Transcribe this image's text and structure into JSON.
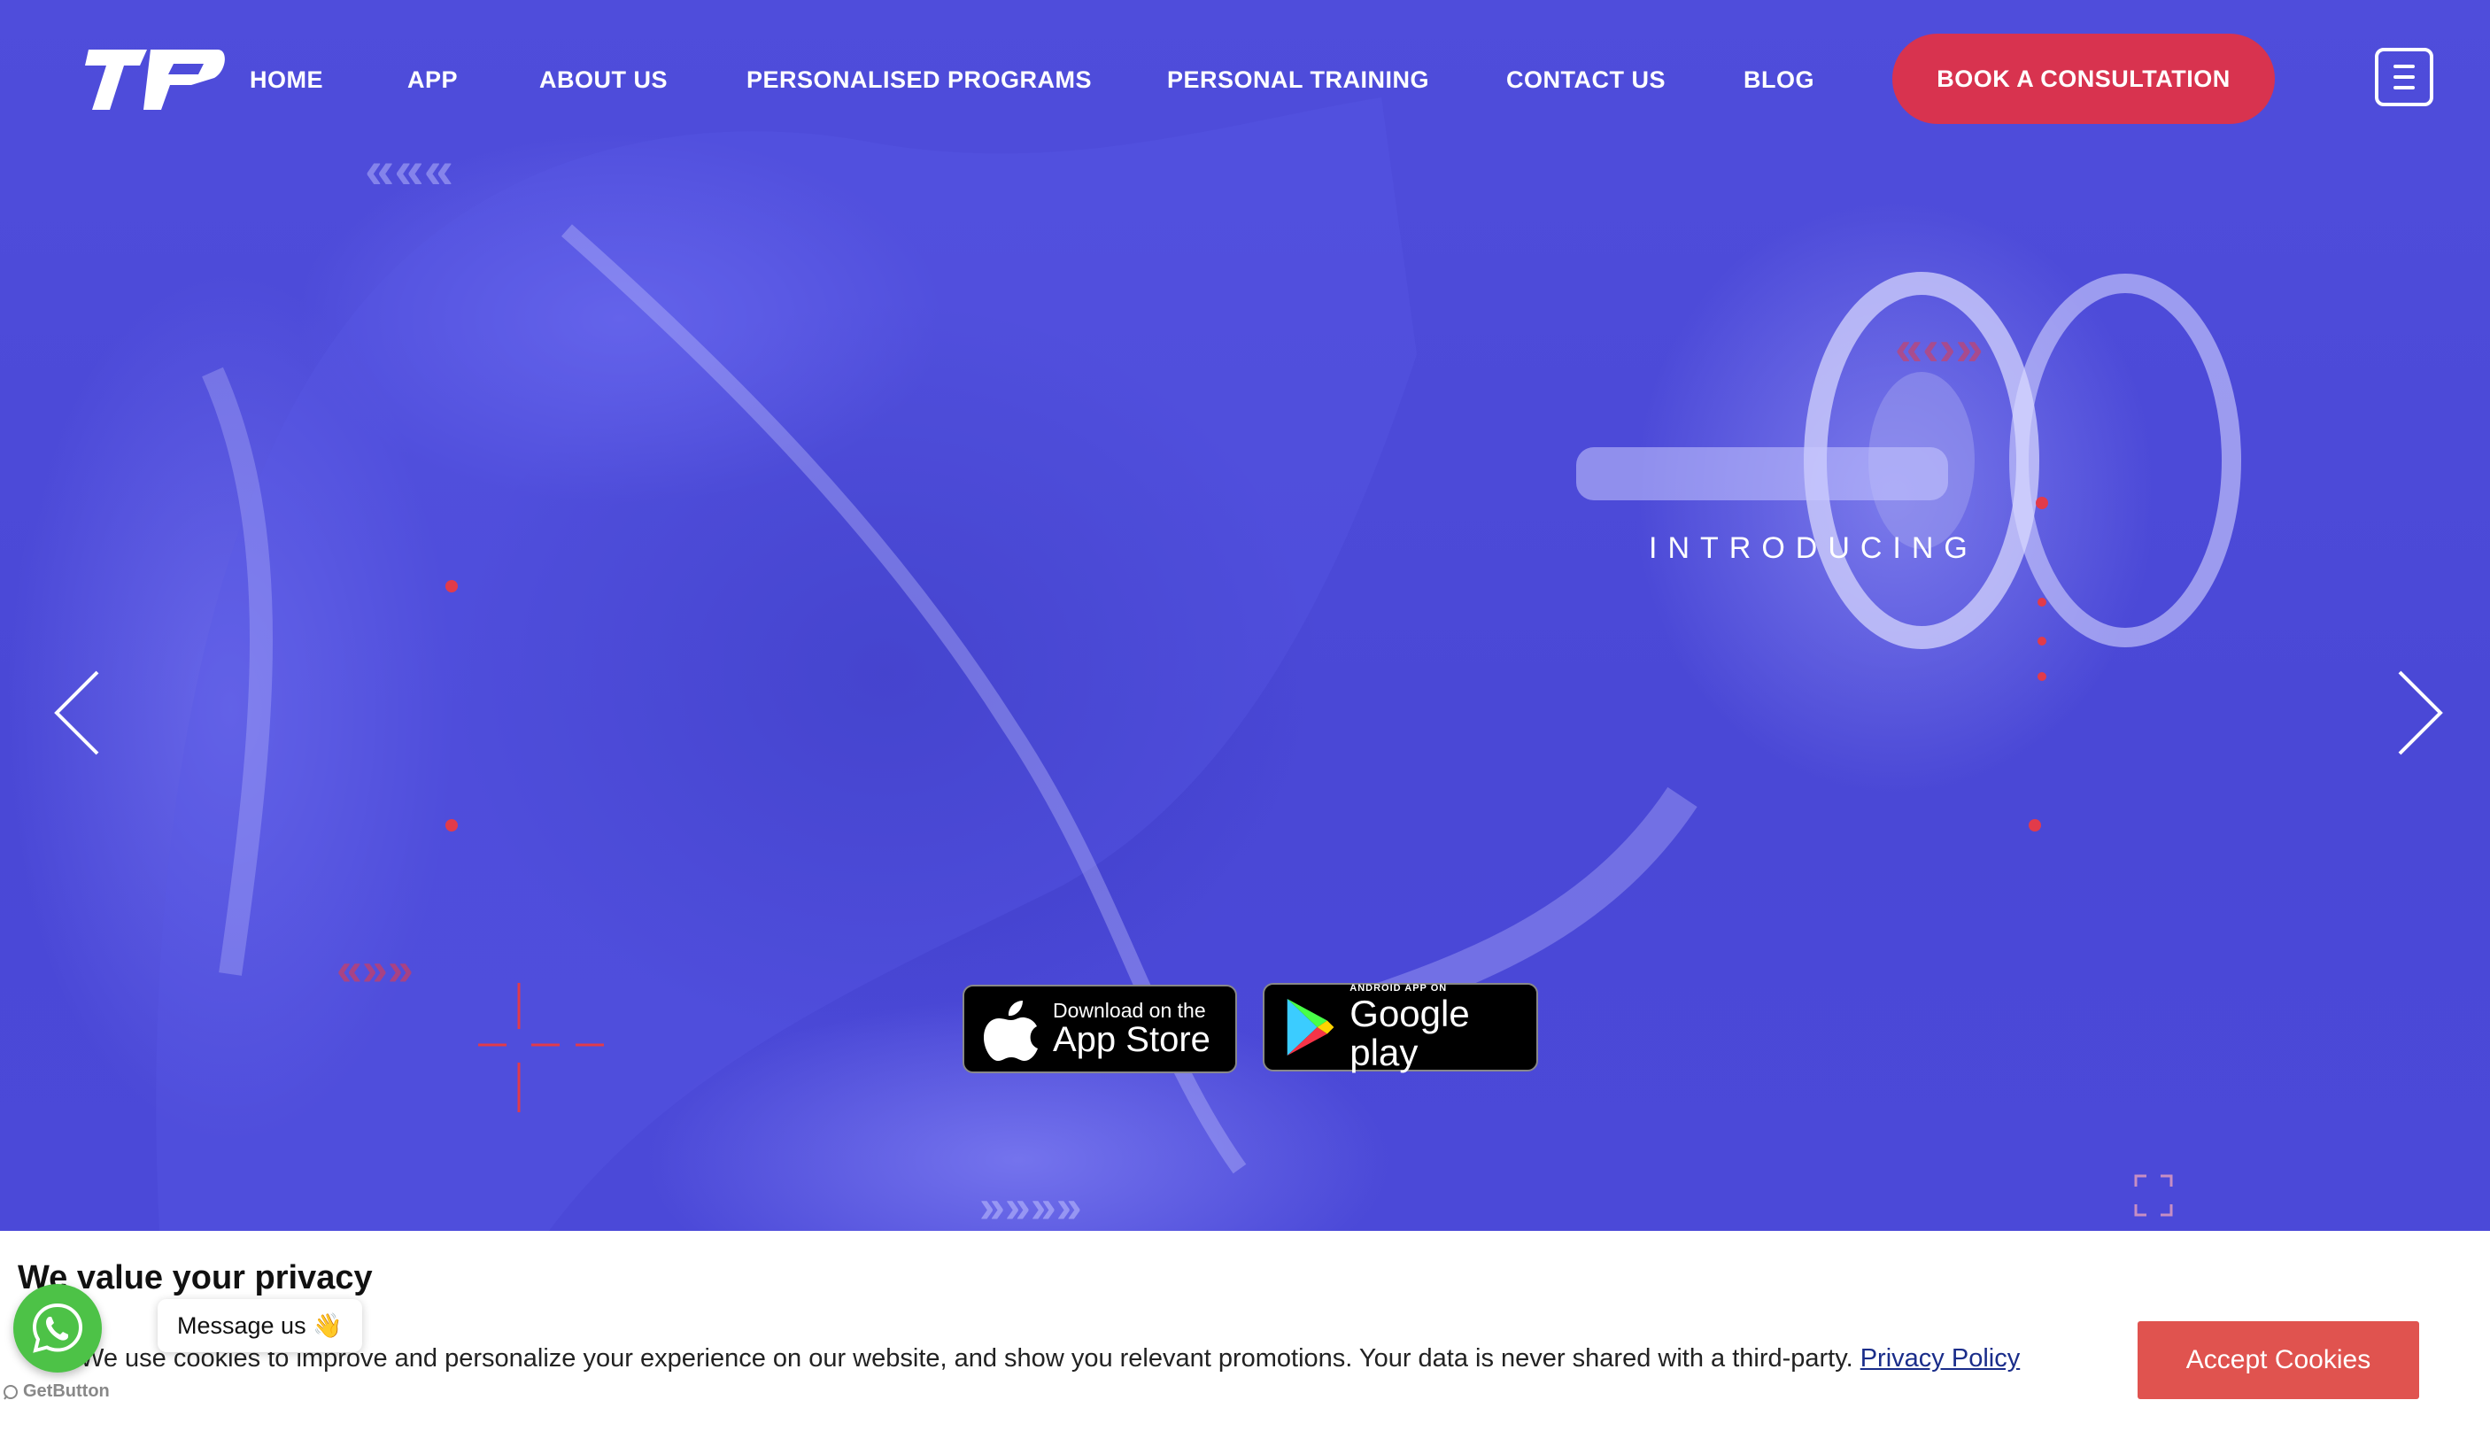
{
  "nav": {
    "items": [
      {
        "label": "HOME"
      },
      {
        "label": "APP"
      },
      {
        "label": "ABOUT US"
      },
      {
        "label": "PERSONALISED PROGRAMS"
      },
      {
        "label": "PERSONAL TRAINING"
      },
      {
        "label": "CONTACT US"
      },
      {
        "label": "BLOG"
      }
    ],
    "cta_label": "BOOK A CONSULTATION",
    "menu_icon": "hamburger-menu-icon"
  },
  "hero": {
    "eyebrow": "INTRODUCING",
    "app_store": {
      "small": "Download on the",
      "big": "App Store"
    },
    "google_play": {
      "small": "ANDROID APP ON",
      "big": "Google play"
    }
  },
  "cookie": {
    "title": "We value your privacy",
    "text": "We use cookies to improve and personalize your experience on our website, and show you relevant promotions. Your data is never shared with a third-party.",
    "link": "Privacy Policy",
    "accept": "Accept Cookies"
  },
  "whatsapp": {
    "bubble": "Message us 👋",
    "credit": "GetButton"
  },
  "colors": {
    "hero_bg": "#4f4ddb",
    "cta": "#d8334f",
    "accept": "#e0534f",
    "whatsapp": "#4dc247",
    "accent_red": "#e23b4a"
  }
}
